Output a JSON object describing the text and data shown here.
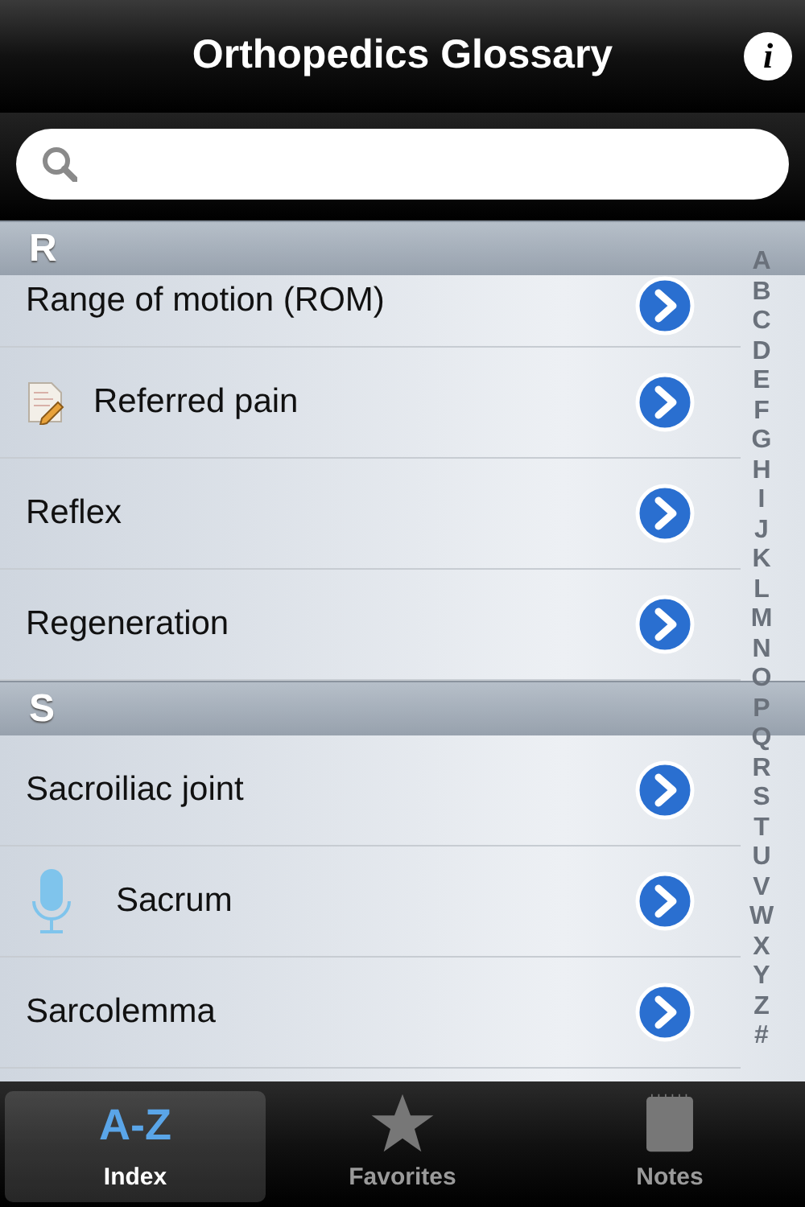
{
  "navbar": {
    "title": "Orthopedics Glossary",
    "info": "i"
  },
  "sections": [
    {
      "letter": "R",
      "rows": [
        {
          "label": "Range of motion (ROM)",
          "kind": "plain",
          "partial": true
        },
        {
          "label": "Referred pain",
          "kind": "note"
        },
        {
          "label": "Reflex",
          "kind": "plain"
        },
        {
          "label": "Regeneration",
          "kind": "plain"
        }
      ]
    },
    {
      "letter": "S",
      "rows": [
        {
          "label": "Sacroiliac joint",
          "kind": "plain"
        },
        {
          "label": "Sacrum",
          "kind": "audio"
        },
        {
          "label": "Sarcolemma",
          "kind": "plain"
        }
      ]
    }
  ],
  "index_letters": [
    "A",
    "B",
    "C",
    "D",
    "E",
    "F",
    "G",
    "H",
    "I",
    "J",
    "K",
    "L",
    "M",
    "N",
    "O",
    "P",
    "Q",
    "R",
    "S",
    "T",
    "U",
    "V",
    "W",
    "X",
    "Y",
    "Z",
    "#"
  ],
  "tabs": [
    {
      "label": "Index",
      "icon_text": "A-Z",
      "kind": "az",
      "selected": true
    },
    {
      "label": "Favorites",
      "kind": "star",
      "selected": false
    },
    {
      "label": "Notes",
      "kind": "notes",
      "selected": false
    }
  ]
}
